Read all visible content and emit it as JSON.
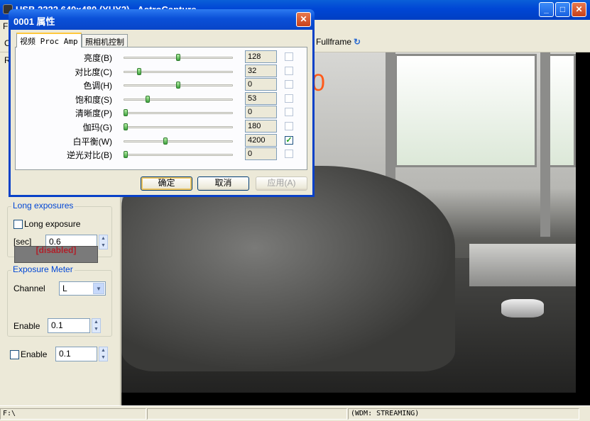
{
  "main_window": {
    "title": "USB 2222 640x480 (YUY2) - AstroCapture",
    "fullframe_label": "Fullframe",
    "fullframe_icon": "refresh-arrow-icon",
    "tab_stub_left": "R",
    "menu_stub": "F",
    "toolbar_stub": "C"
  },
  "overlay_number": "0",
  "left_panel": {
    "long_exposures": {
      "legend": "Long exposures",
      "checkbox_label": "Long exposure",
      "checked": false,
      "sec_label": "[sec]",
      "sec_value": "0.6"
    },
    "exposure_meter": {
      "legend": "Exposure Meter",
      "channel_label": "Channel",
      "channel_value": "L",
      "disabled_text": "[disabled]",
      "enable_label": "Enable",
      "enable_value": "0.1",
      "enable2_label": "Enable",
      "enable2_value": "0.1",
      "enable2_checked": false
    }
  },
  "statusbar": {
    "path": "F:\\",
    "middle": "",
    "status": "(WDM: STREAMING)"
  },
  "dialog": {
    "title": "0001 属性",
    "tabs": [
      {
        "label": "视频 Proc Amp",
        "active": true
      },
      {
        "label": "照相机控制",
        "active": false
      }
    ],
    "properties": [
      {
        "label": "亮度(B)",
        "value": "128",
        "pos": 0.5,
        "auto": false
      },
      {
        "label": "对比度(C)",
        "value": "32",
        "pos": 0.13,
        "auto": false
      },
      {
        "label": "色调(H)",
        "value": "0",
        "pos": 0.5,
        "auto": false
      },
      {
        "label": "饱和度(S)",
        "value": "53",
        "pos": 0.21,
        "auto": false
      },
      {
        "label": "清晰度(P)",
        "value": "0",
        "pos": 0.0,
        "auto": false
      },
      {
        "label": "伽玛(G)",
        "value": "180",
        "pos": 0.0,
        "auto": false
      },
      {
        "label": "白平衡(W)",
        "value": "4200",
        "pos": 0.38,
        "auto": true
      },
      {
        "label": "逆光对比(B)",
        "value": "0",
        "pos": 0.0,
        "auto": false
      }
    ],
    "buttons": {
      "ok": "确定",
      "cancel": "取消",
      "apply": "应用(A)"
    }
  }
}
